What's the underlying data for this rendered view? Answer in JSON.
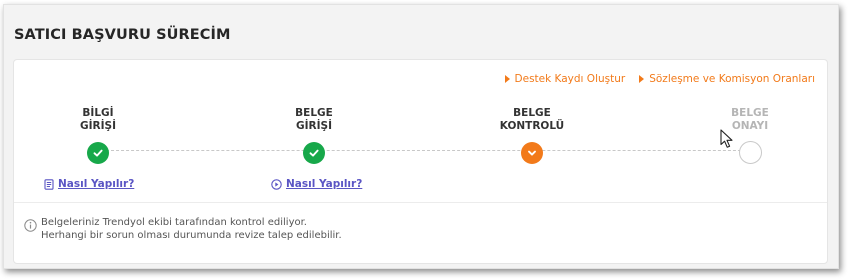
{
  "page": {
    "title": "SATICI BAŞVURU SÜRECİM"
  },
  "links": {
    "support": "Destek Kaydı Oluştur",
    "contract": "Sözleşme ve Komisyon Oranları"
  },
  "steps": [
    {
      "label_line1": "BİLGİ",
      "label_line2": "GİRİŞİ",
      "status": "completed"
    },
    {
      "label_line1": "BELGE",
      "label_line2": "GİRİŞİ",
      "status": "completed"
    },
    {
      "label_line1": "BELGE",
      "label_line2": "KONTROLÜ",
      "status": "in-progress"
    },
    {
      "label_line1": "BELGE",
      "label_line2": "ONAYI",
      "status": "pending"
    }
  ],
  "help_links": [
    {
      "label": "Nasıl Yapılır?",
      "icon": "document-icon"
    },
    {
      "label": "Nasıl Yapılır?",
      "icon": "play-icon"
    }
  ],
  "info": {
    "line1": "Belgeleriniz Trendyol ekibi tarafından kontrol ediliyor.",
    "line2": "Herhangi bir sorun olması durumunda revize talep edilebilir."
  },
  "colors": {
    "accent": "#f27a1a",
    "success": "#17a84a",
    "link": "#5a55c4",
    "muted": "#b5b5b5"
  }
}
